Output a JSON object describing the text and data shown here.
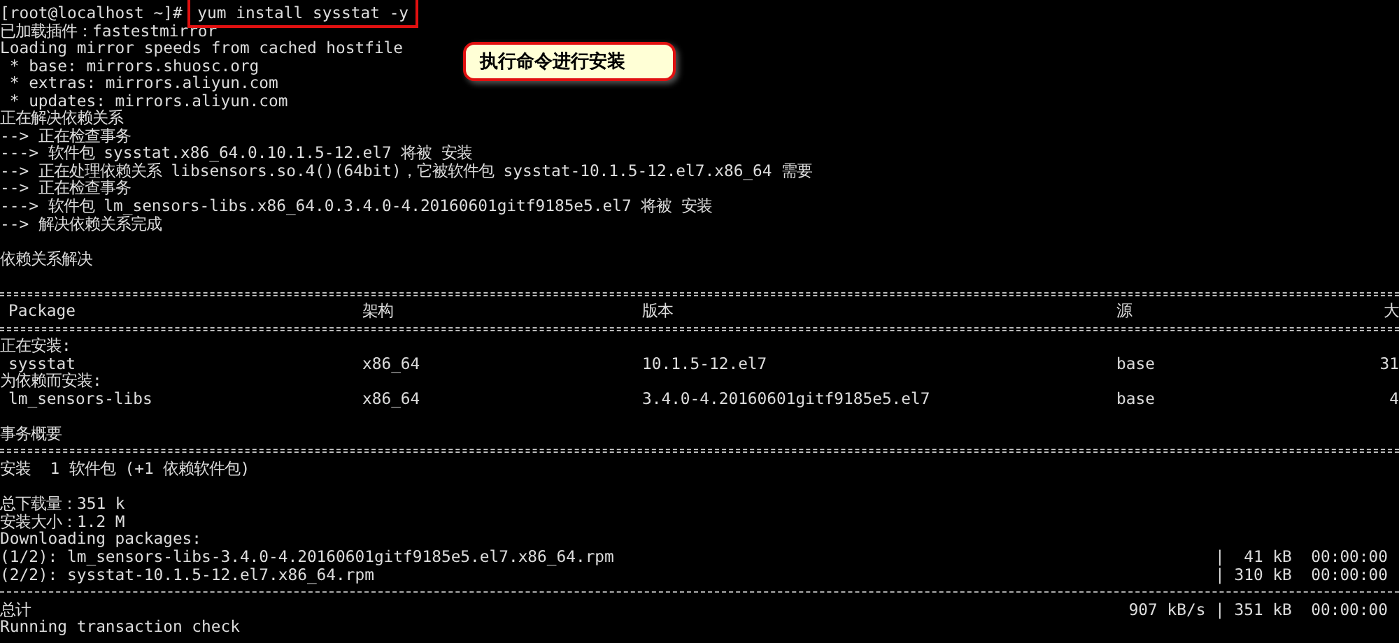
{
  "prompt": "[root@localhost ~]#",
  "command": {
    "text": "yum install sysstat -y",
    "highlighted": true
  },
  "callout": "执行命令进行安装",
  "blocks": [
    {
      "kind": "line",
      "text": "已加载插件：fastestmirror"
    },
    {
      "kind": "line",
      "text": "Loading mirror speeds from cached hostfile"
    },
    {
      "kind": "line",
      "text": " * base: mirrors.shuosc.org"
    },
    {
      "kind": "line",
      "text": " * extras: mirrors.aliyun.com"
    },
    {
      "kind": "line",
      "text": " * updates: mirrors.aliyun.com"
    },
    {
      "kind": "line",
      "text": "正在解决依赖关系"
    },
    {
      "kind": "line",
      "text": "--> 正在检查事务"
    },
    {
      "kind": "line",
      "text": "---> 软件包 sysstat.x86_64.0.10.1.5-12.el7 将被 安装"
    },
    {
      "kind": "line",
      "text": "--> 正在处理依赖关系 libsensors.so.4()(64bit)，它被软件包 sysstat-10.1.5-12.el7.x86_64 需要"
    },
    {
      "kind": "line",
      "text": "--> 正在检查事务"
    },
    {
      "kind": "line",
      "text": "---> 软件包 lm_sensors-libs.x86_64.0.3.4.0-4.20160601gitf9185e5.el7 将被 安装"
    },
    {
      "kind": "line",
      "text": "--> 解决依赖关系完成"
    },
    {
      "kind": "gap"
    },
    {
      "kind": "line",
      "text": "依赖关系解决"
    },
    {
      "kind": "gap"
    },
    {
      "kind": "double_rule"
    },
    {
      "kind": "header",
      "cells": [
        "Package",
        "架构",
        "版本",
        "源",
        "大"
      ]
    },
    {
      "kind": "double_rule"
    },
    {
      "kind": "line",
      "text": "正在安装:"
    },
    {
      "kind": "row",
      "cells": [
        "sysstat",
        "x86_64",
        "10.1.5-12.el7",
        "base",
        "31"
      ]
    },
    {
      "kind": "line",
      "text": "为依赖而安装:"
    },
    {
      "kind": "row",
      "cells": [
        "lm_sensors-libs",
        "x86_64",
        "3.4.0-4.20160601gitf9185e5.el7",
        "base",
        "4"
      ]
    },
    {
      "kind": "gap"
    },
    {
      "kind": "line",
      "text": "事务概要"
    },
    {
      "kind": "double_rule"
    },
    {
      "kind": "line",
      "text": "安装  1 软件包 (+1 依赖软件包)"
    },
    {
      "kind": "gap"
    },
    {
      "kind": "line",
      "text": "总下载量：351 k"
    },
    {
      "kind": "line",
      "text": "安装大小：1.2 M"
    },
    {
      "kind": "line",
      "text": "Downloading packages:"
    },
    {
      "kind": "progress",
      "left": "(1/2): lm_sensors-libs-3.4.0-4.20160601gitf9185e5.el7.x86_64.rpm",
      "right": "|  41 kB  00:00:00"
    },
    {
      "kind": "progress",
      "left": "(2/2): sysstat-10.1.5-12.el7.x86_64.rpm",
      "right": "| 310 kB  00:00:00"
    },
    {
      "kind": "dashed_rule"
    },
    {
      "kind": "progress",
      "left": "总计",
      "right": "907 kB/s | 351 kB  00:00:00"
    },
    {
      "kind": "line",
      "text": "Running transaction check"
    }
  ]
}
